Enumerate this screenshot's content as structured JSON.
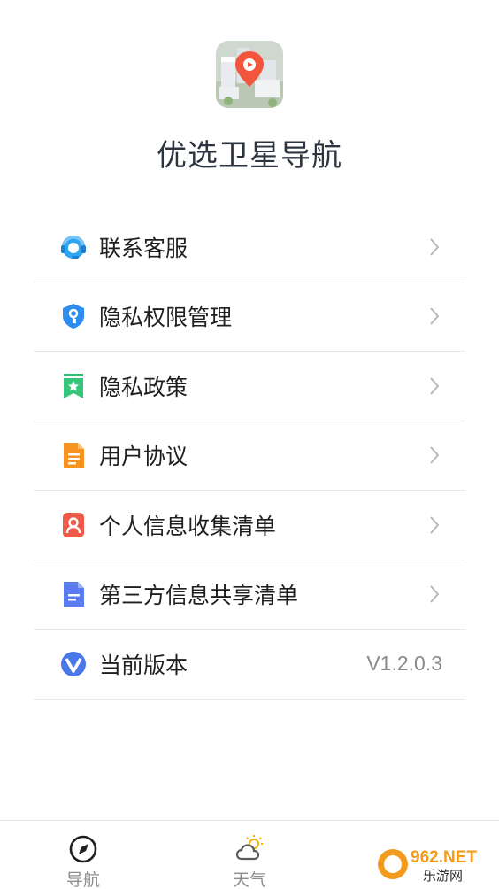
{
  "app": {
    "title": "优选卫星导航"
  },
  "menu": {
    "items": [
      {
        "label": "联系客服",
        "icon": "headset-icon"
      },
      {
        "label": "隐私权限管理",
        "icon": "shield-key-icon"
      },
      {
        "label": "隐私政策",
        "icon": "bookmark-star-icon"
      },
      {
        "label": "用户协议",
        "icon": "document-icon"
      },
      {
        "label": "个人信息收集清单",
        "icon": "person-card-icon"
      },
      {
        "label": "第三方信息共享清单",
        "icon": "list-doc-icon"
      }
    ],
    "version": {
      "label": "当前版本",
      "value": "V1.2.0.3",
      "icon": "v-logo-icon"
    }
  },
  "tabbar": {
    "tabs": [
      {
        "label": "导航",
        "icon": "compass-icon"
      },
      {
        "label": "天气",
        "icon": "weather-icon"
      }
    ]
  },
  "watermark": {
    "text_top": "962.NET",
    "text_bottom": "乐游网"
  },
  "colors": {
    "title": "#2c3440",
    "divider": "#e6e6e6",
    "chevron": "#b8b8b8"
  }
}
